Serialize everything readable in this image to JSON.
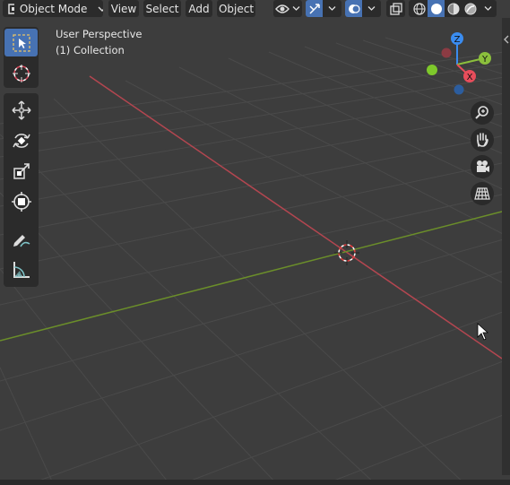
{
  "header": {
    "mode_label": "Object Mode",
    "menus": [
      "View",
      "Select",
      "Add",
      "Object"
    ],
    "icons": [
      "visibility-eye-icon",
      "gizmo-icon",
      "overlay-icon",
      "xray-icon",
      "wireframe-shading-icon",
      "solid-shading-icon",
      "material-shading-icon",
      "rendered-shading-icon"
    ]
  },
  "overlay": {
    "view_name": "User Perspective",
    "collection": "(1) Collection"
  },
  "gizmo": {
    "axes": [
      "Z",
      "Y",
      "X"
    ],
    "colors": {
      "x": "#e84d5b",
      "y": "#8bbf3c",
      "z": "#3a8cf0"
    }
  },
  "toolbar": {
    "tools": [
      "select-box",
      "cursor",
      "move",
      "rotate",
      "scale",
      "transform",
      "annotate",
      "measure"
    ]
  },
  "nav_buttons": [
    "zoom",
    "pan",
    "camera",
    "perspective-toggle"
  ],
  "colors": {
    "background": "#3d3d3d",
    "grid": "#4a4a4a",
    "x_axis": "#b34650",
    "y_axis": "#6b8e2a",
    "active_tool": "#4772b3"
  }
}
